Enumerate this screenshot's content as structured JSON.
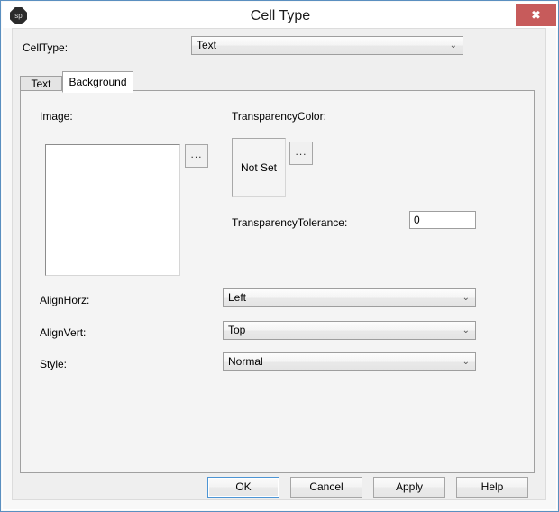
{
  "window": {
    "title": "Cell Type",
    "icon_label": "sp",
    "close_label": "✖"
  },
  "celltype_row": {
    "label": "CellType:",
    "value": "Text",
    "arrow": "⌄"
  },
  "tabs": [
    {
      "label": "Text",
      "active": false
    },
    {
      "label": "Background",
      "active": true
    }
  ],
  "background_tab": {
    "image": {
      "label": "Image:",
      "preview_value": "",
      "browse_label": "..."
    },
    "transparency_color": {
      "label": "TransparencyColor:",
      "value": "Not Set",
      "browse_label": "..."
    },
    "transparency_tolerance": {
      "label": "TransparencyTolerance:",
      "value": "0",
      "placeholder": ""
    },
    "align_horz": {
      "label": "AlignHorz:",
      "value": "Left",
      "arrow": "⌄"
    },
    "align_vert": {
      "label": "AlignVert:",
      "value": "Top",
      "arrow": "⌄"
    },
    "style": {
      "label": "Style:",
      "value": "Normal",
      "arrow": "⌄"
    }
  },
  "footer": {
    "ok": "OK",
    "cancel": "Cancel",
    "apply": "Apply",
    "help": "Help"
  },
  "colors": {
    "titlebar_bg": "#ffffff",
    "close_bg": "#c75b5b",
    "window_border": "#5a8fc0",
    "client_bg": "#efefef",
    "tabpanel_bg": "#f4f4f4",
    "default_button_border": "#4d95d4"
  }
}
